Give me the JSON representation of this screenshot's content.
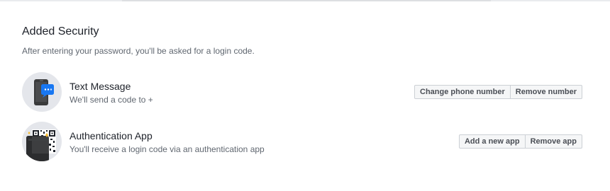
{
  "section": {
    "title": "Added Security",
    "description": "After entering your password, you'll be asked for a login code."
  },
  "methods": [
    {
      "icon": "phone-sms-icon",
      "title": "Text Message",
      "subtitle": "We'll send a code to +",
      "buttons": [
        "Change phone number",
        "Remove number"
      ]
    },
    {
      "icon": "qr-code-app-icon",
      "title": "Authentication App",
      "subtitle": "You'll receive a login code via an authentication app",
      "buttons": [
        "Add a new app",
        "Remove app"
      ]
    }
  ],
  "colors": {
    "accent_blue": "#1877f2",
    "icon_circle": "#e4e6eb",
    "button_bg": "#f5f6f7",
    "button_border": "#ccd0d5",
    "title_text": "#1d2129",
    "secondary_text": "#606770"
  }
}
